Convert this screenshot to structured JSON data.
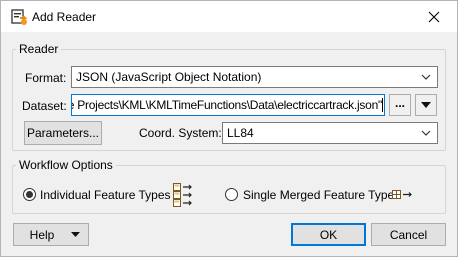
{
  "window": {
    "title": "Add Reader",
    "close_icon": "close-icon",
    "app_icon": "add-reader-icon"
  },
  "reader": {
    "legend": "Reader",
    "format_label": "Format:",
    "format_value": "JSON (JavaScript Object Notation)",
    "dataset_label": "Dataset:",
    "dataset_value": "Safe Projects\\KML\\KMLTimeFunctions\\Data\\electriccartrack.json\"",
    "browse_label": "...",
    "parameters_label": "Parameters...",
    "coord_label": "Coord. System:",
    "coord_value": "LL84"
  },
  "workflow": {
    "legend": "Workflow Options",
    "individual_label": "Individual Feature Types",
    "individual_selected": true,
    "merged_label": "Single Merged Feature Type",
    "merged_selected": false
  },
  "footer": {
    "help_label": "Help",
    "ok_label": "OK",
    "cancel_label": "Cancel"
  },
  "colors": {
    "focus_border": "#0078d7",
    "dialog_bg": "#f0f0f0",
    "button_bg": "#e1e1e1"
  }
}
